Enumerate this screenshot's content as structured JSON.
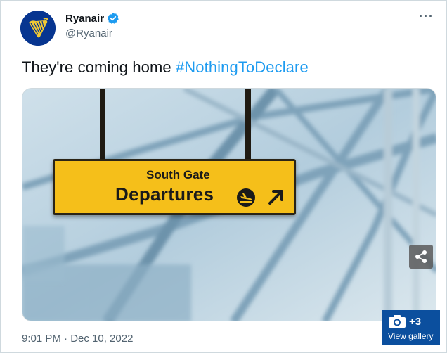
{
  "author": {
    "display_name": "Ryanair",
    "handle": "@Ryanair"
  },
  "tweet": {
    "text": "They're coming home ",
    "hashtag": "#NothingToDeclare",
    "timestamp": "9:01 PM · Dec 10, 2022"
  },
  "media": {
    "sign_line1": "South Gate",
    "sign_line2": "Departures"
  },
  "gallery": {
    "count": "+3",
    "label": "View gallery"
  },
  "colors": {
    "brand_blue": "#073590",
    "link_blue": "#1d9bf0",
    "sign_yellow": "#f5bf1a",
    "gallery_blue": "#0b4f9e"
  }
}
